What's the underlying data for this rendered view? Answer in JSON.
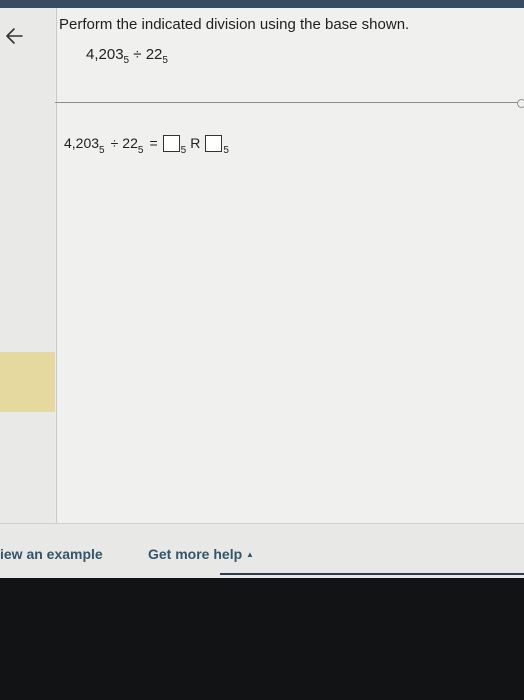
{
  "page": {
    "prompt": "Perform the indicated division using the base shown.",
    "problem": {
      "dividend": "4,203",
      "dividend_base": "5",
      "operator": "÷",
      "divisor": "22",
      "divisor_base": "5"
    },
    "answer_row": {
      "dividend": "4,203",
      "dividend_base": "5",
      "operator": "÷",
      "divisor": "22",
      "divisor_base": "5",
      "equals": "=",
      "quotient_base": "5",
      "remainder_label": "R",
      "remainder_base": "5"
    }
  },
  "footer": {
    "view_example": "iew an example",
    "get_more_help": "Get more help",
    "help_caret": "▲"
  }
}
